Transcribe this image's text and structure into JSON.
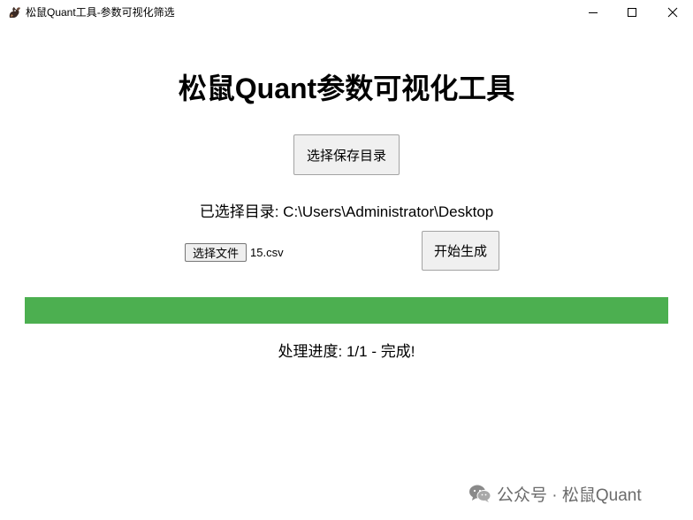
{
  "window": {
    "title": "松鼠Quant工具-参数可视化筛选",
    "icon": "squirrel-app-icon"
  },
  "main": {
    "heading": "松鼠Quant参数可视化工具",
    "select_dir_label": "选择保存目录",
    "selected_dir_text": "已选择目录: C:\\Users\\Administrator\\Desktop",
    "choose_file_label": "选择文件",
    "file_name": "15.csv",
    "start_label": "开始生成"
  },
  "progress": {
    "percent": 100,
    "color": "#4caf50",
    "status_text": "处理进度: 1/1 - 完成!"
  },
  "watermark": {
    "text": "公众号 · 松鼠Quant",
    "icon": "wechat-icon"
  }
}
